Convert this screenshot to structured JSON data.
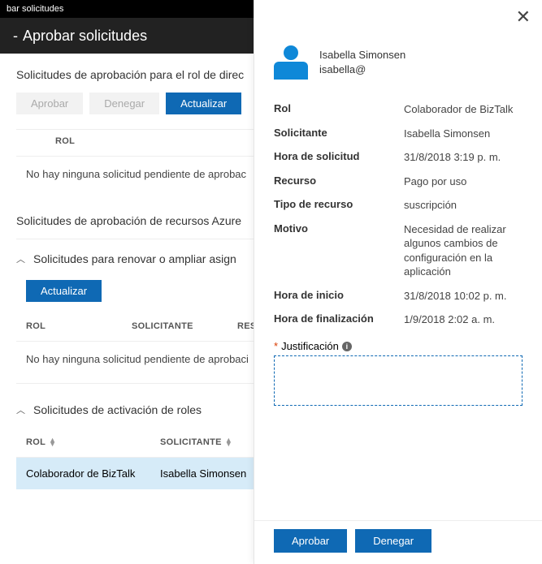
{
  "topbar": {
    "title": "bar solicitudes"
  },
  "header": {
    "title": "Aprobar solicitudes"
  },
  "section1": {
    "title": "Solicitudes de aprobación para el rol de direc",
    "approve": "Aprobar",
    "deny": "Denegar",
    "refresh": "Actualizar",
    "col_role": "ROL",
    "empty": "No hay ninguna solicitud pendiente de aprobac"
  },
  "section2": {
    "title": "Solicitudes de aprobación de recursos Azure",
    "sub1": {
      "heading": "Solicitudes para renovar o ampliar asign",
      "refresh": "Actualizar",
      "col_role": "ROL",
      "col_requester": "SOLICITANTE",
      "col_resource": "RESO",
      "empty": "No hay ninguna solicitud pendiente de aprobaci"
    },
    "sub2": {
      "heading": "Solicitudes de activación de roles",
      "col_role": "ROL",
      "col_requester": "SOLICITANTE",
      "row": {
        "role": "Colaborador de BizTalk",
        "requester": "Isabella Simonsen"
      }
    }
  },
  "panel": {
    "user_name": "Isabella Simonsen",
    "user_email": "isabella@",
    "fields": {
      "rol_lbl": "Rol",
      "rol_val": "Colaborador de BizTalk",
      "sol_lbl": "Solicitante",
      "sol_val": "Isabella Simonsen",
      "hs_lbl": "Hora de solicitud",
      "hs_val": "31/8/2018 3:19 p. m.",
      "rec_lbl": "Recurso",
      "rec_val": "Pago por uso",
      "tr_lbl": "Tipo de recurso",
      "tr_val": "suscripción",
      "mot_lbl": "Motivo",
      "mot_val": "Necesidad de realizar algunos cambios de configuración en la aplicación",
      "hi_lbl": "Hora de inicio",
      "hi_val": "31/8/2018 10:02 p. m.",
      "hf_lbl": "Hora de finalización",
      "hf_val": "1/9/2018 2:02 a. m."
    },
    "just_label": "Justificación",
    "approve": "Aprobar",
    "deny": "Denegar"
  }
}
